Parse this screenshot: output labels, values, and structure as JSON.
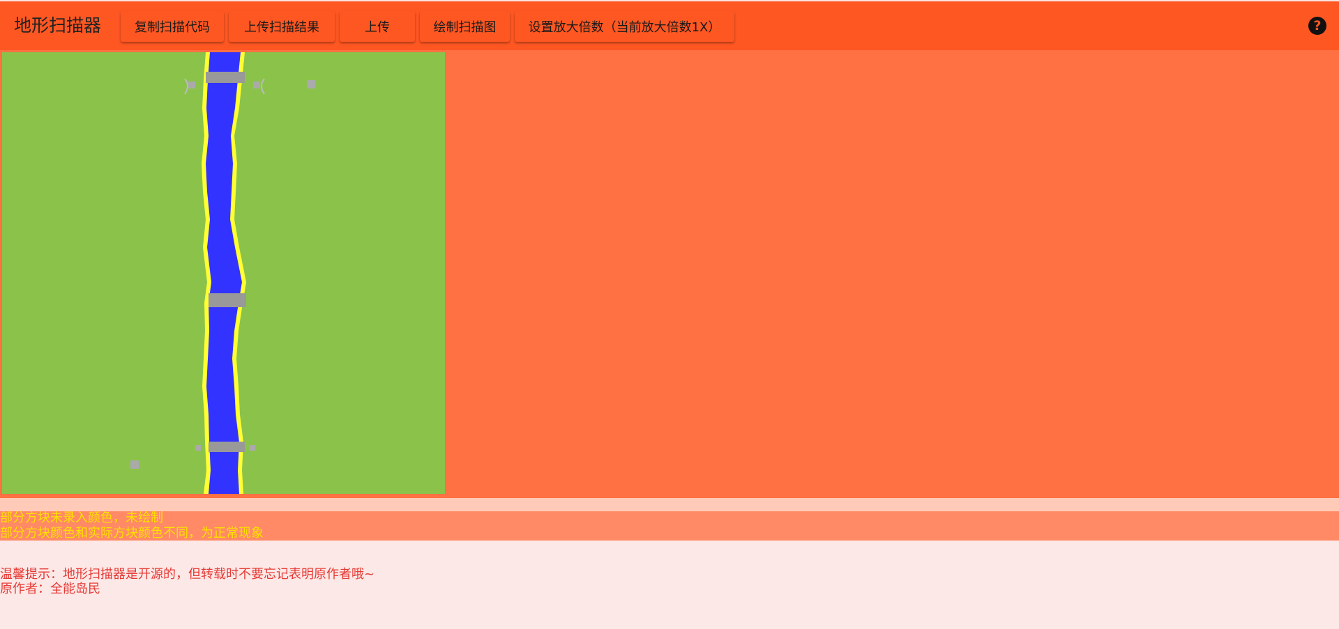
{
  "app": {
    "title": "地形扫描器",
    "help_icon": "question-circle-icon"
  },
  "toolbar": {
    "buttons": [
      {
        "label": "复制扫描代码"
      },
      {
        "label": "上传扫描结果"
      },
      {
        "label": "上传"
      },
      {
        "label": "绘制扫描图"
      },
      {
        "label": "设置放大倍数（当前放大倍数1X）"
      }
    ]
  },
  "map": {
    "grass_color": "#8bc34a",
    "water_color": "#3333ff",
    "sand_color": "#ffff33",
    "stone_color": "#999999"
  },
  "warnings": {
    "line1": "部分方块未录入颜色，未绘制",
    "line2": "部分方块颜色和实际方块颜色不同，为正常现象"
  },
  "notes": {
    "tip": "温馨提示：地形扫描器是开源的，但转载时不要忘记表明原作者哦~",
    "author": "原作者：全能岛民"
  },
  "colors": {
    "appbar": "#ff5722",
    "stage": "#ff7043",
    "warning_text": "#ffe000",
    "note_text": "#e53935"
  }
}
